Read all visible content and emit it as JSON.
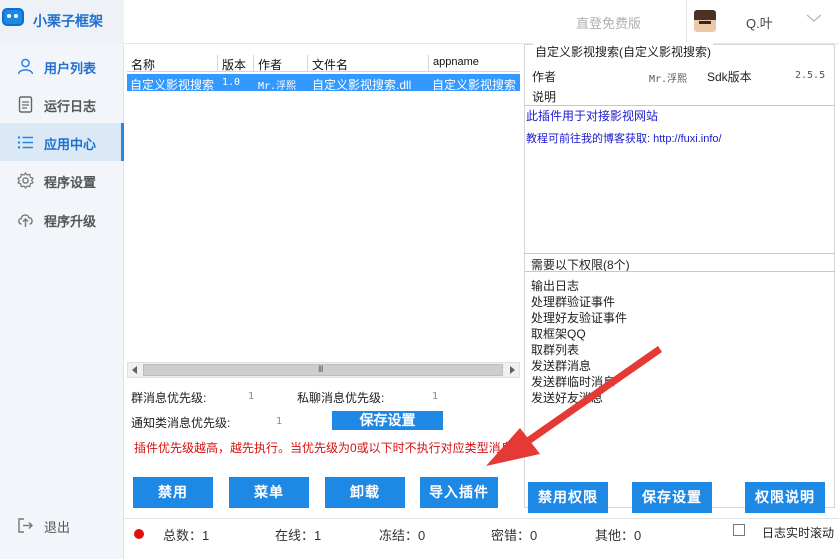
{
  "app": {
    "title": "小栗子框架",
    "login_free": "直登免费版",
    "user_name": "Q.叶"
  },
  "sidebar": {
    "items": [
      {
        "label": "用户列表",
        "icon": "user-icon"
      },
      {
        "label": "运行日志",
        "icon": "document-icon"
      },
      {
        "label": "应用中心",
        "icon": "list-icon"
      },
      {
        "label": "程序设置",
        "icon": "gear-icon"
      },
      {
        "label": "程序升级",
        "icon": "cloud-upload-icon"
      }
    ],
    "active_index": 2,
    "exit_label": "退出"
  },
  "table": {
    "columns": [
      "名称",
      "版本",
      "作者",
      "文件名",
      "appname"
    ],
    "rows": [
      [
        "自定义影视搜索",
        "1.0",
        "Mr.浮熙",
        "自定义影视搜索.dll",
        "自定义影视搜索"
      ]
    ],
    "selected_row": 0
  },
  "priority": {
    "group_label": "群消息优先级:",
    "group_value": "1",
    "private_label": "私聊消息优先级:",
    "private_value": "1",
    "notice_label": "通知类消息优先级:",
    "notice_value": "1",
    "save_label": "保存设置",
    "note": "插件优先级越高，越先执行。当优先级为0或以下时不执行对应类型消息"
  },
  "actions": {
    "disable": "禁用",
    "menu": "菜单",
    "uninstall": "卸载",
    "import": "导入插件",
    "disable_perm": "禁用权限",
    "save_settings": "保存设置",
    "perm_help": "权限说明"
  },
  "detail": {
    "title": "自定义影视搜索(自定义影视搜索)",
    "author_label": "作者",
    "author_value": "Mr.浮熙",
    "sdk_label": "Sdk版本",
    "sdk_value": "2.5.5",
    "desc_label": "说明",
    "desc_line1": "此插件用于对接影视网站",
    "desc_line2": "教程可前往我的博客获取: http://fuxi.info/",
    "perm_header": "需要以下权限(8个)",
    "permissions": [
      "输出日志",
      "处理群验证事件",
      "处理好友验证事件",
      "取框架QQ",
      "取群列表",
      "发送群消息",
      "发送群临时消息",
      "发送好友消息"
    ]
  },
  "status": {
    "total": "总数：1",
    "online": "在线：1",
    "frozen": "冻结：0",
    "pwd_error": "密错：0",
    "other": "其他：0",
    "log_scroll": "日志实时滚动"
  },
  "colors": {
    "accent": "#1e88e5",
    "selected_row": "#3399ff",
    "warning": "#d61010",
    "link": "#1a1ad0",
    "arrow": "#e53935"
  }
}
